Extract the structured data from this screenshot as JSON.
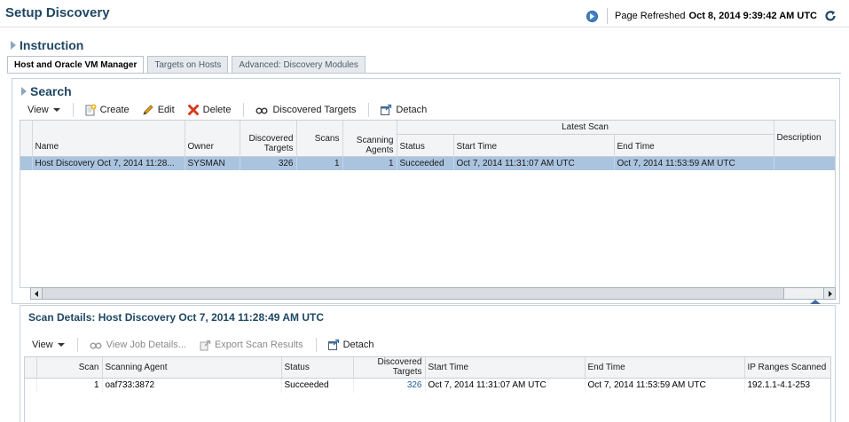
{
  "header": {
    "title": "Setup Discovery",
    "refresh_label": "Page Refreshed",
    "refresh_time": "Oct 8, 2014 9:39:42 AM UTC"
  },
  "instruction": {
    "label": "Instruction"
  },
  "tabs": [
    {
      "label": "Host and Oracle VM Manager",
      "active": true
    },
    {
      "label": "Targets on Hosts",
      "active": false
    },
    {
      "label": "Advanced: Discovery Modules",
      "active": false
    }
  ],
  "search": {
    "label": "Search",
    "toolbar": {
      "view": "View",
      "create": "Create",
      "edit": "Edit",
      "delete": "Delete",
      "discovered_targets": "Discovered Targets",
      "detach": "Detach"
    },
    "group_header": "Latest Scan",
    "columns": {
      "name": "Name",
      "owner": "Owner",
      "discovered_targets_1": "Discovered",
      "discovered_targets_2": "Targets",
      "scans": "Scans",
      "scanning_agents_1": "Scanning",
      "scanning_agents_2": "Agents",
      "status": "Status",
      "start_time": "Start Time",
      "end_time": "End Time",
      "description": "Description"
    },
    "rows": [
      {
        "name": "Host Discovery Oct 7, 2014 11:28...",
        "owner": "SYSMAN",
        "discovered_targets": "326",
        "scans": "1",
        "scanning_agents": "1",
        "status": "Succeeded",
        "start_time": "Oct 7, 2014 11:31:07 AM UTC",
        "end_time": "Oct 7, 2014 11:53:59 AM UTC",
        "description": ""
      }
    ]
  },
  "scan_details": {
    "title": "Scan Details: Host Discovery Oct 7, 2014 11:28:49 AM UTC",
    "toolbar": {
      "view": "View",
      "view_job_details": "View Job Details...",
      "export_scan_results": "Export Scan Results",
      "detach": "Detach"
    },
    "columns": {
      "scan": "Scan",
      "scanning_agent": "Scanning Agent",
      "status": "Status",
      "discovered_targets_1": "Discovered",
      "discovered_targets_2": "Targets",
      "start_time": "Start Time",
      "end_time": "End Time",
      "ip_ranges": "IP Ranges Scanned"
    },
    "rows": [
      {
        "scan": "1",
        "scanning_agent": "oaf733:3872",
        "status": "Succeeded",
        "discovered_targets": "326",
        "start_time": "Oct 7, 2014 11:31:07 AM UTC",
        "end_time": "Oct 7, 2014 11:53:59 AM UTC",
        "ip_ranges": "192.1.1-4.1-253"
      }
    ]
  },
  "colors": {
    "title": "#1f4763",
    "selected_row": "#aac4e0",
    "link": "#1f5b9a",
    "delete_icon": "#d83a1f"
  }
}
